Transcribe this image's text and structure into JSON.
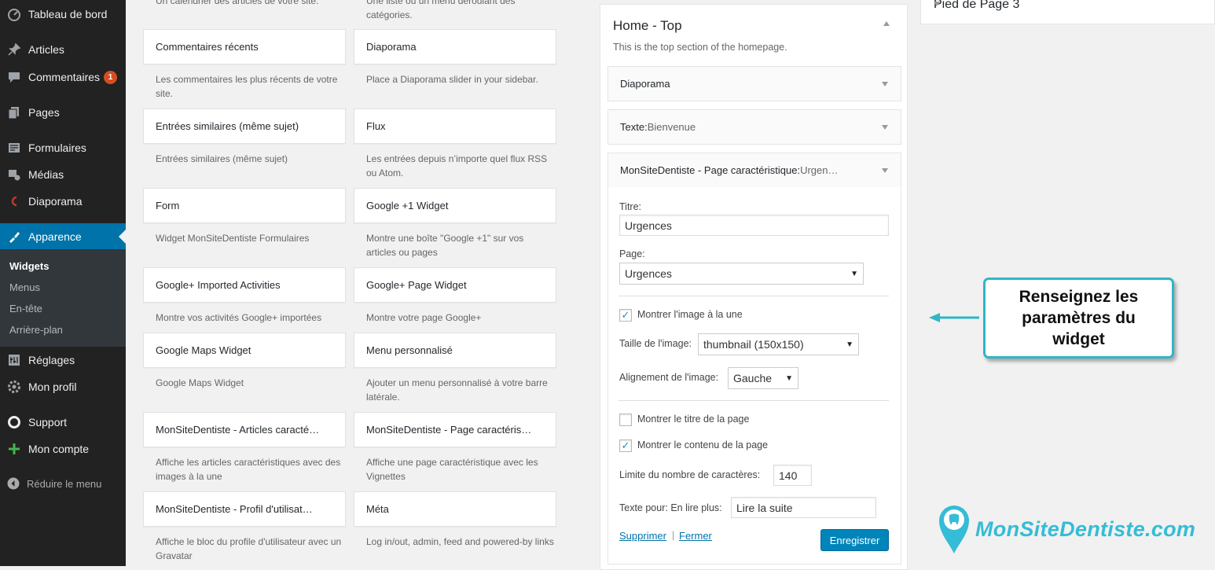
{
  "admin_menu": {
    "items": [
      {
        "label": "Tableau de bord",
        "icon": "dashboard-icon"
      },
      {
        "label": "Articles",
        "icon": "pin-icon"
      },
      {
        "label": "Commentaires",
        "icon": "comment-icon",
        "badge": "1"
      },
      {
        "label": "Pages",
        "icon": "pages-icon"
      },
      {
        "label": "Formulaires",
        "icon": "forms-icon"
      },
      {
        "label": "Médias",
        "icon": "media-icon"
      },
      {
        "label": "Diaporama",
        "icon": "slideshow-icon"
      },
      {
        "label": "Apparence",
        "icon": "appearance-icon",
        "active": true
      },
      {
        "label": "Réglages",
        "icon": "settings-icon"
      },
      {
        "label": "Mon profil",
        "icon": "profile-icon"
      },
      {
        "label": "Support",
        "icon": "support-icon"
      },
      {
        "label": "Mon compte",
        "icon": "plus-icon"
      }
    ],
    "submenu": [
      "Widgets",
      "Menus",
      "En-tête",
      "Arrière-plan"
    ],
    "collapse_label": "Réduire le menu"
  },
  "available_widgets": {
    "top_descriptions": [
      "Un calendrier des articles de votre site.",
      "Une liste ou un menu déroulant des catégories."
    ],
    "rows": [
      [
        {
          "title": "Commentaires récents",
          "desc": "Les commentaires les plus récents de votre site."
        },
        {
          "title": "Diaporama",
          "desc": "Place a Diaporama slider in your sidebar."
        }
      ],
      [
        {
          "title": "Entrées similaires (même sujet)",
          "desc": "Entrées similaires (même sujet)"
        },
        {
          "title": "Flux",
          "desc": "Les entrées depuis n’importe quel flux RSS ou Atom."
        }
      ],
      [
        {
          "title": "Form",
          "desc": "Widget MonSiteDentiste Formulaires"
        },
        {
          "title": "Google +1 Widget",
          "desc": "Montre une boîte \"Google +1\" sur vos articles ou pages"
        }
      ],
      [
        {
          "title": "Google+ Imported Activities",
          "desc": "Montre vos activités Google+ importées"
        },
        {
          "title": "Google+ Page Widget",
          "desc": "Montre votre page Google+"
        }
      ],
      [
        {
          "title": "Google Maps Widget",
          "desc": "Google Maps Widget"
        },
        {
          "title": "Menu personnalisé",
          "desc": "Ajouter un menu personnalisé à votre barre latérale."
        }
      ],
      [
        {
          "title": "MonSiteDentiste - Articles caracté…",
          "desc": "Affiche les articles caractéristiques avec des images à la une"
        },
        {
          "title": "MonSiteDentiste - Page caractéris…",
          "desc": "Affiche une page caractéristique avec les Vignettes"
        }
      ],
      [
        {
          "title": "MonSiteDentiste - Profil d'utilisat…",
          "desc": "Affiche le bloc du profile d'utilisateur avec un Gravatar"
        },
        {
          "title": "Méta",
          "desc": "Log in/out, admin, feed and powered-by links"
        }
      ]
    ]
  },
  "sidebar_area": {
    "title": "Home - Top",
    "description": "This is the top section of the homepage.",
    "widgets": [
      {
        "title": "Diaporama",
        "sub": ""
      },
      {
        "title": "Texte:",
        "sub": " Bienvenue"
      },
      {
        "title": "MonSiteDentiste - Page caractéristique:",
        "sub": " Urgen…"
      }
    ]
  },
  "widget_form": {
    "titre_label": "Titre:",
    "titre_value": "Urgences",
    "page_label": "Page:",
    "page_value": "Urgences",
    "show_image_label": "Montrer l'image à la une",
    "show_image_checked": true,
    "image_size_label": "Taille de l'image:",
    "image_size_value": "thumbnail (150x150)",
    "image_align_label": "Alignement de l'image:",
    "image_align_value": "Gauche",
    "show_title_label": "Montrer le titre de la page",
    "show_title_checked": false,
    "show_content_label": "Montrer le contenu de la page",
    "show_content_checked": true,
    "char_limit_label": "Limite du nombre de caractères:",
    "char_limit_value": "140",
    "readmore_label": "Texte pour: En lire plus:",
    "readmore_value": "Lire la suite",
    "delete_label": "Supprimer",
    "separator": "|",
    "close_label": "Fermer",
    "save_label": "Enregistrer"
  },
  "right_area": {
    "title": "Pied de Page 3"
  },
  "annotation": {
    "callout_text": "Renseignez les paramètres du widget",
    "arrow_color": "#2fb6c7"
  },
  "brand": {
    "text": "MonSiteDentiste.com",
    "color": "#35bcd6"
  },
  "colors": {
    "admin_bar": "#222222",
    "accent": "#0073aa",
    "button": "#0085ba",
    "badge": "#d54e21"
  }
}
